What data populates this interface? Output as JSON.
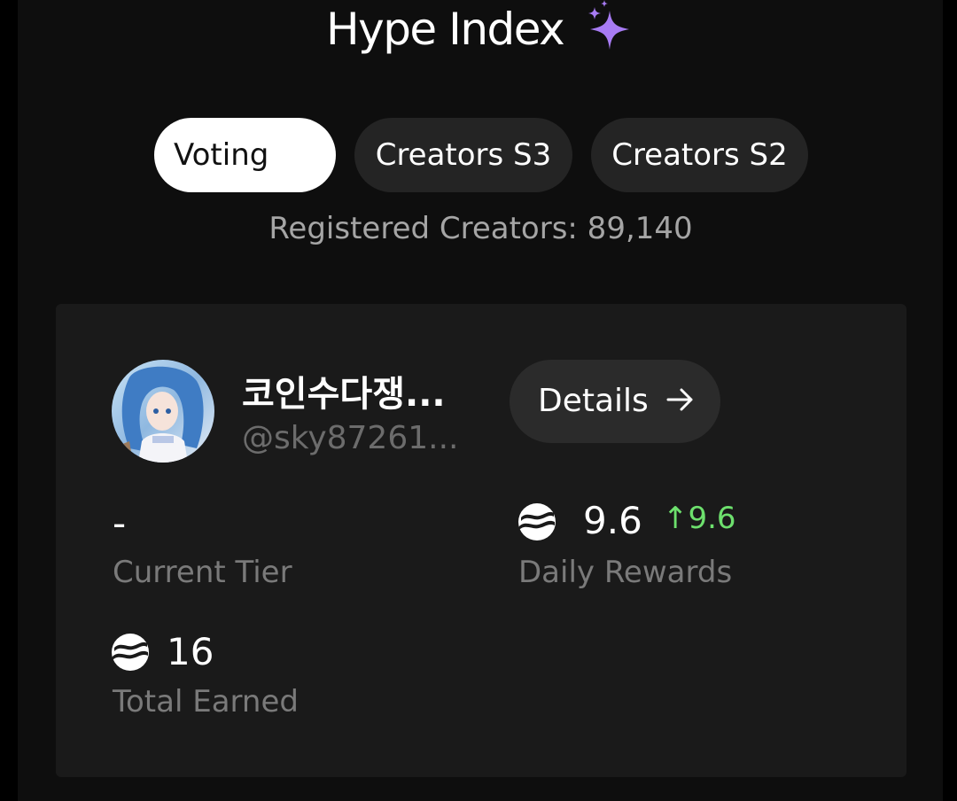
{
  "header": {
    "title": "Hype Index",
    "title_icon": "sparkles-icon"
  },
  "tabs": [
    {
      "label": "Voting",
      "active": true
    },
    {
      "label": "Creators S3",
      "active": false
    },
    {
      "label": "Creators S2",
      "active": false
    }
  ],
  "registered_creators": "Registered Creators: 89,140",
  "creator": {
    "name": "코인수다쟁...",
    "handle": "@sky87261...",
    "avatar": "anime-avatar",
    "details_label": "Details"
  },
  "stats": {
    "tier_value": "-",
    "tier_label": "Current Tier",
    "daily_value": "9.6",
    "daily_delta": "↑9.6",
    "daily_label": "Daily Rewards",
    "total_value": "16",
    "total_label": "Total Earned",
    "coin_icon": "coin-icon"
  },
  "colors": {
    "accent_purple": "#a77bf3",
    "positive_green": "#6de06d",
    "card_bg": "#1a1a1a",
    "tab_bg": "#242424"
  }
}
